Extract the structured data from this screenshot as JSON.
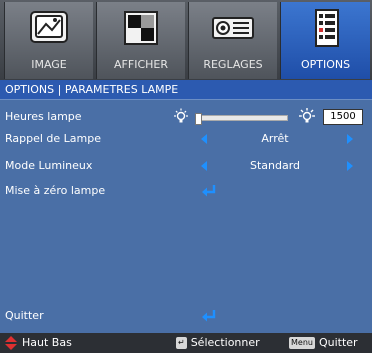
{
  "tabs": [
    {
      "label": "IMAGE",
      "icon": "image-icon",
      "active": false
    },
    {
      "label": "AFFICHER",
      "icon": "display-icon",
      "active": false
    },
    {
      "label": "REGLAGES",
      "icon": "projector-icon",
      "active": false
    },
    {
      "label": "OPTIONS",
      "icon": "options-checklist-icon",
      "active": true
    }
  ],
  "title": "OPTIONS | PARAMETRES LAMPE",
  "rows": {
    "lamp_hours": {
      "label": "Heures lampe",
      "value": "1500"
    },
    "lamp_reminder": {
      "label": "Rappel de Lampe",
      "value": "Arrêt"
    },
    "brightness_mode": {
      "label": "Mode Lumineux",
      "value": "Standard"
    },
    "lamp_reset": {
      "label": "Mise à zéro lampe"
    },
    "quit": {
      "label": "Quitter"
    }
  },
  "bottom": {
    "nav": "Haut Bas",
    "select": "Sélectionner",
    "menu_key": "Menu",
    "quit": "Quitter"
  },
  "colors": {
    "panel": "#4a6fa6",
    "title_bar": "#2c5ab0",
    "active_tab": "#1f4ea8",
    "arrow": "#1e90ff",
    "bottom_bar": "#2c2f34",
    "nav_icon": "#e03030"
  }
}
